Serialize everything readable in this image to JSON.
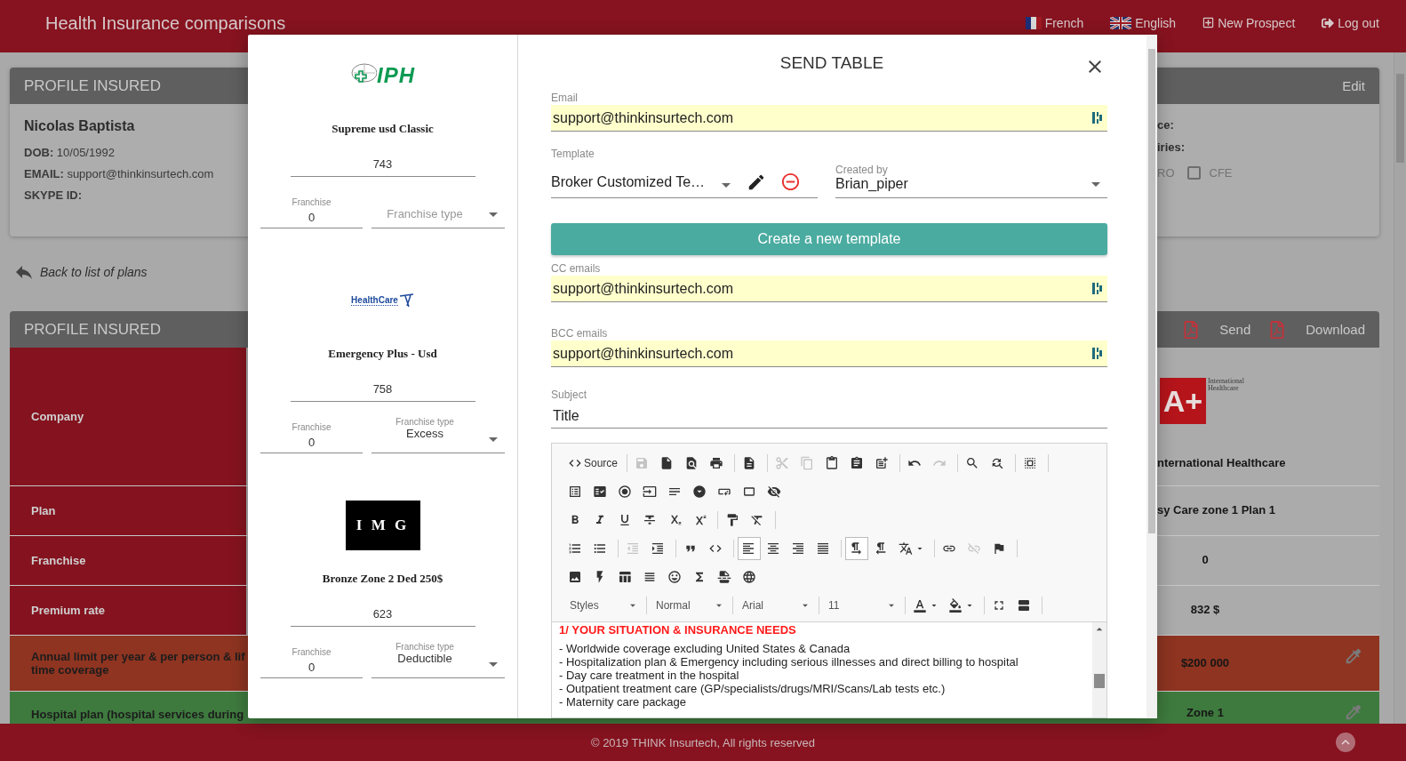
{
  "header": {
    "title": "Health Insurance comparisons",
    "nav": [
      {
        "kind": "flag-fr",
        "label": "French"
      },
      {
        "kind": "flag-uk",
        "label": "English"
      },
      {
        "kind": "new",
        "label": "New Prospect"
      },
      {
        "kind": "logout",
        "label": "Log out"
      }
    ]
  },
  "profile": {
    "title": "PROFILE INSURED",
    "action": "Edit",
    "name": "Nicolas Baptista",
    "fields": [
      {
        "label": "DOB:",
        "value": "10/05/1992"
      },
      {
        "label": "EMAIL:",
        "value": "support@thinkinsurtech.com"
      },
      {
        "label": "SKYPE ID:"
      }
    ],
    "right_lines": [
      "ce:",
      "iries:"
    ],
    "option_cut": "RO",
    "option": {
      "label": "CFE",
      "checked": false
    }
  },
  "back_link": "Back to list of plans",
  "comparison": {
    "title": "PROFILE INSURED",
    "actions": [
      "Send",
      "Download"
    ],
    "rows": [
      {
        "kind": "logo",
        "label": "Company",
        "color": "#84131f",
        "logo": {
          "mark": "A+",
          "caption": "International Healthcare"
        },
        "value": "nternational Healthcare"
      },
      {
        "kind": "text",
        "label": "Plan",
        "color": "#84131f",
        "value": "sy Care zone 1 Plan 1"
      },
      {
        "kind": "number",
        "label": "Franchise",
        "color": "#84131f",
        "value": "0"
      },
      {
        "kind": "number",
        "label": "Premium rate",
        "color": "#84131f",
        "value": "832 $"
      },
      {
        "kind": "editable",
        "label": "Annual limit per year & per person & lif\ntime coverage",
        "color": "#8e3421",
        "value": "$200 000"
      },
      {
        "kind": "editable",
        "label": "Hospital plan (hospital services during",
        "color": "#3e7a3e",
        "value": "Zone 1"
      }
    ]
  },
  "modal": {
    "plans": [
      {
        "logo": {
          "kind": "iph",
          "text": "IPH"
        },
        "name": "Supreme usd Classic",
        "price": "743",
        "franchise": {
          "label": "Franchise",
          "value": "0"
        },
        "type": {
          "placeholder": "Franchise type"
        }
      },
      {
        "logo": {
          "kind": "healthcare",
          "text": "HealthCare"
        },
        "name": "Emergency Plus - Usd",
        "price": "758",
        "franchise": {
          "label": "Franchise",
          "value": "0"
        },
        "type": {
          "label": "Franchise type",
          "value": "Excess"
        }
      },
      {
        "logo": {
          "kind": "img",
          "text": "I M G"
        },
        "name": "Bronze Zone 2 Ded 250$",
        "price": "623",
        "franchise": {
          "label": "Franchise",
          "value": "0"
        },
        "type": {
          "label": "Franchise type",
          "value": "Deductible"
        }
      }
    ],
    "title": "SEND TABLE",
    "email": {
      "label": "Email",
      "value": "support@thinkinsurtech.com"
    },
    "template": {
      "label": "Template",
      "value": "Broker Customized Te…"
    },
    "created_by": {
      "label": "Created by",
      "value": "Brian_piper"
    },
    "create_button": "Create a new template",
    "cc": {
      "label": "CC emails",
      "value": "support@thinkinsurtech.com"
    },
    "bcc": {
      "label": "BCC emails",
      "value": "support@thinkinsurtech.com"
    },
    "subject": {
      "label": "Subject",
      "value": "Title"
    },
    "toolbar": [
      [
        {
          "kind": "button",
          "label": "Source",
          "disabled": false,
          "selected": false
        },
        {
          "kind": "separator"
        },
        {
          "kind": "button",
          "disabled": true,
          "selected": false
        },
        {
          "kind": "button",
          "disabled": false,
          "selected": false
        },
        {
          "kind": "button",
          "disabled": false,
          "selected": false
        },
        {
          "kind": "button",
          "disabled": false,
          "selected": false
        },
        {
          "kind": "separator"
        },
        {
          "kind": "button",
          "disabled": false,
          "selected": false
        },
        {
          "kind": "separator"
        },
        {
          "kind": "button",
          "disabled": true,
          "selected": false
        },
        {
          "kind": "button",
          "disabled": true,
          "selected": false
        },
        {
          "kind": "button",
          "disabled": false,
          "selected": false
        },
        {
          "kind": "button",
          "disabled": false,
          "selected": false
        },
        {
          "kind": "button",
          "disabled": false,
          "selected": false
        },
        {
          "kind": "separator"
        },
        {
          "kind": "button",
          "disabled": false,
          "selected": false
        },
        {
          "kind": "button",
          "disabled": true,
          "selected": false
        },
        {
          "kind": "separator"
        },
        {
          "kind": "button",
          "disabled": false,
          "selected": false
        },
        {
          "kind": "button",
          "disabled": false,
          "selected": false
        },
        {
          "kind": "separator"
        },
        {
          "kind": "button",
          "disabled": false,
          "selected": false
        },
        {
          "kind": "separator"
        }
      ],
      [
        {
          "kind": "button",
          "disabled": false,
          "selected": false
        },
        {
          "kind": "button",
          "disabled": false,
          "selected": false
        },
        {
          "kind": "button",
          "disabled": false,
          "selected": false
        },
        {
          "kind": "button",
          "disabled": false,
          "selected": false
        },
        {
          "kind": "button",
          "disabled": false,
          "selected": false
        },
        {
          "kind": "button",
          "disabled": false,
          "selected": false
        },
        {
          "kind": "button",
          "disabled": false,
          "selected": false
        },
        {
          "kind": "button",
          "disabled": false,
          "selected": false
        },
        {
          "kind": "button",
          "disabled": false,
          "selected": false
        }
      ],
      [
        {
          "kind": "button",
          "disabled": false,
          "selected": false
        },
        {
          "kind": "button",
          "disabled": false,
          "selected": false
        },
        {
          "kind": "button",
          "disabled": false,
          "selected": false
        },
        {
          "kind": "button",
          "disabled": false,
          "selected": false
        },
        {
          "kind": "button",
          "disabled": false,
          "selected": false
        },
        {
          "kind": "button",
          "disabled": false,
          "selected": false
        },
        {
          "kind": "separator"
        },
        {
          "kind": "button",
          "disabled": false,
          "selected": false
        },
        {
          "kind": "button",
          "disabled": false,
          "selected": false
        },
        {
          "kind": "separator"
        }
      ],
      [
        {
          "kind": "button",
          "disabled": false,
          "selected": false
        },
        {
          "kind": "button",
          "disabled": false,
          "selected": false
        },
        {
          "kind": "separator"
        },
        {
          "kind": "button",
          "disabled": true,
          "selected": false
        },
        {
          "kind": "button",
          "disabled": false,
          "selected": false
        },
        {
          "kind": "separator"
        },
        {
          "kind": "button",
          "disabled": false,
          "selected": false
        },
        {
          "kind": "button",
          "disabled": false,
          "selected": false
        },
        {
          "kind": "separator"
        },
        {
          "kind": "button",
          "disabled": false,
          "selected": true
        },
        {
          "kind": "button",
          "disabled": false,
          "selected": false
        },
        {
          "kind": "button",
          "disabled": false,
          "selected": false
        },
        {
          "kind": "button",
          "disabled": false,
          "selected": false
        },
        {
          "kind": "separator"
        },
        {
          "kind": "button",
          "disabled": false,
          "selected": true
        },
        {
          "kind": "button",
          "disabled": false,
          "selected": false
        },
        {
          "kind": "menu",
          "disabled": false,
          "selected": false
        },
        {
          "kind": "separator"
        },
        {
          "kind": "button",
          "disabled": false,
          "selected": false
        },
        {
          "kind": "button",
          "disabled": true,
          "selected": false
        },
        {
          "kind": "button",
          "disabled": false,
          "selected": false
        },
        {
          "kind": "separator"
        }
      ],
      [
        {
          "kind": "button",
          "disabled": false,
          "selected": false
        },
        {
          "kind": "button",
          "disabled": false,
          "selected": false
        },
        {
          "kind": "button",
          "disabled": false,
          "selected": false
        },
        {
          "kind": "button",
          "disabled": false,
          "selected": false
        },
        {
          "kind": "button",
          "disabled": false,
          "selected": false
        },
        {
          "kind": "button",
          "disabled": false,
          "selected": false
        },
        {
          "kind": "button",
          "disabled": false,
          "selected": false
        },
        {
          "kind": "button",
          "disabled": false,
          "selected": false
        }
      ],
      [
        {
          "kind": "dropdown",
          "label": "Styles"
        },
        {
          "kind": "separator"
        },
        {
          "kind": "dropdown",
          "label": "Normal"
        },
        {
          "kind": "separator"
        },
        {
          "kind": "dropdown",
          "label": "Arial"
        },
        {
          "kind": "separator"
        },
        {
          "kind": "dropdown",
          "label": "11"
        },
        {
          "kind": "separator"
        },
        {
          "kind": "menu",
          "disabled": false,
          "selected": false
        },
        {
          "kind": "menu",
          "disabled": false,
          "selected": false
        },
        {
          "kind": "separator"
        },
        {
          "kind": "button",
          "disabled": false,
          "selected": false
        },
        {
          "kind": "button",
          "disabled": false,
          "selected": false
        },
        {
          "kind": "separator"
        }
      ]
    ],
    "content": {
      "heading": "1/ YOUR SITUATION & INSURANCE NEEDS",
      "lines": [
        "- Worldwide coverage excluding United States & Canada",
        "- Hospitalization plan & Emergency including serious illnesses and direct billing to hospital",
        "- Day care treatment in the hospital",
        "- Outpatient treatment care (GP/specialists/drugs/MRI/Scans/Lab tests etc.)",
        "- Maternity care package"
      ]
    }
  },
  "footer": "© 2019 THINK Insurtech, All rights reserved"
}
